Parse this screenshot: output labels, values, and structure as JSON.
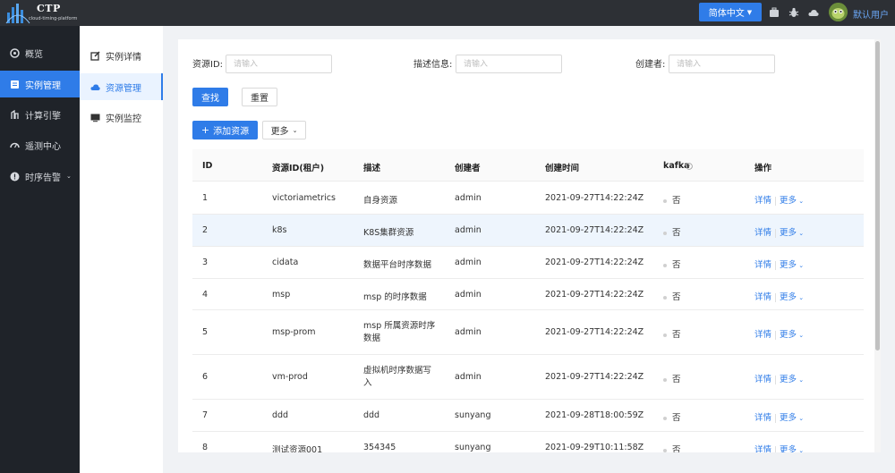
{
  "header": {
    "logo_title": "CTP",
    "logo_subtitle": "cloud-timing-platform",
    "language": "简体中文",
    "user": "默认用户",
    "icons": [
      "briefcase-icon",
      "bug-icon",
      "cloud-icon"
    ]
  },
  "nav": {
    "items": [
      {
        "label": "概览",
        "icon": "dashboard-icon"
      },
      {
        "label": "实例管理",
        "icon": "instance-icon"
      },
      {
        "label": "计算引擎",
        "icon": "engine-icon"
      },
      {
        "label": "遥测中心",
        "icon": "telemetry-icon"
      },
      {
        "label": "时序告警",
        "icon": "alert-icon"
      }
    ],
    "active": "实例管理"
  },
  "subnav": {
    "items": [
      {
        "label": "实例详情",
        "icon": "edit-icon"
      },
      {
        "label": "资源管理",
        "icon": "cloud-icon"
      },
      {
        "label": "实例监控",
        "icon": "monitor-icon"
      }
    ],
    "active": "资源管理"
  },
  "filters": {
    "resource_id_label": "资源ID:",
    "description_label": "描述信息:",
    "creator_label": "创建者:",
    "placeholder": "请输入"
  },
  "actions": {
    "search": "查找",
    "reset": "重置",
    "add_resource": "添加资源",
    "more": "更多"
  },
  "table": {
    "columns": [
      "ID",
      "资源ID(租户)",
      "描述",
      "创建者",
      "创建时间",
      "kafka",
      "操作"
    ],
    "rows": [
      {
        "id": "1",
        "resource": "victoriametrics",
        "desc": "自身资源",
        "creator": "admin",
        "time": "2021-09-27T14:22:24Z",
        "kafka": "否"
      },
      {
        "id": "2",
        "resource": "k8s",
        "desc": "K8S集群资源",
        "creator": "admin",
        "time": "2021-09-27T14:22:24Z",
        "kafka": "否"
      },
      {
        "id": "3",
        "resource": "cidata",
        "desc": "数据平台时序数据",
        "creator": "admin",
        "time": "2021-09-27T14:22:24Z",
        "kafka": "否"
      },
      {
        "id": "4",
        "resource": "msp",
        "desc": "msp 的时序数据",
        "creator": "admin",
        "time": "2021-09-27T14:22:24Z",
        "kafka": "否"
      },
      {
        "id": "5",
        "resource": "msp-prom",
        "desc": "msp 所属资源时序数据",
        "creator": "admin",
        "time": "2021-09-27T14:22:24Z",
        "kafka": "否"
      },
      {
        "id": "6",
        "resource": "vm-prod",
        "desc": "虚拟机时序数据写入",
        "creator": "admin",
        "time": "2021-09-27T14:22:24Z",
        "kafka": "否"
      },
      {
        "id": "7",
        "resource": "ddd",
        "desc": "ddd",
        "creator": "sunyang",
        "time": "2021-09-28T18:00:59Z",
        "kafka": "否"
      },
      {
        "id": "8",
        "resource": "测试资源001",
        "desc": "354345",
        "creator": "sunyang",
        "time": "2021-09-29T10:11:58Z",
        "kafka": "否"
      }
    ],
    "row_detail": "详情",
    "row_more": "更多"
  },
  "colors": {
    "primary": "#2f7ce8",
    "topbar": "#2d3035",
    "sidebar": "#1f2329"
  }
}
